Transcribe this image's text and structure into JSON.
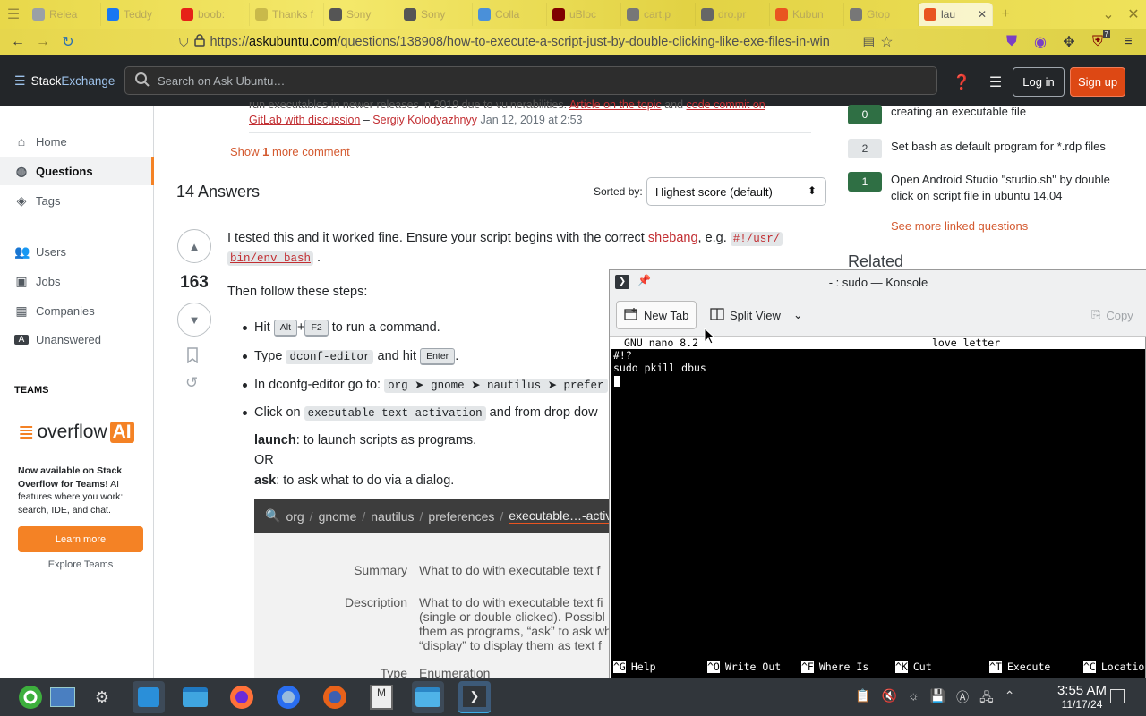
{
  "browser": {
    "tabs": [
      {
        "label": "Relea",
        "color": "#9aa0a6"
      },
      {
        "label": "Teddy",
        "color": "#1877f2"
      },
      {
        "label": "boob:",
        "color": "#e62117"
      },
      {
        "label": "Thanks f",
        "color": "#c9b94a"
      },
      {
        "label": "Sony",
        "color": "#555555"
      },
      {
        "label": "Sony",
        "color": "#555555"
      },
      {
        "label": "Colla",
        "color": "#4a90d9"
      },
      {
        "label": "uBloc",
        "color": "#800000"
      },
      {
        "label": "cart.p",
        "color": "#777777"
      },
      {
        "label": "dro.pr",
        "color": "#666666"
      },
      {
        "label": "Kubun",
        "color": "#e95420"
      },
      {
        "label": "Gtop",
        "color": "#777777"
      },
      {
        "label": "lau",
        "color": "#e95420",
        "active": true
      }
    ],
    "url_prefix": "https://",
    "url_domain": "askubuntu.com",
    "url_path": "/questions/138908/how-to-execute-a-script-just-by-double-clicking-like-exe-files-in-win",
    "ublock_count": "7"
  },
  "header": {
    "logo_a": "Stack",
    "logo_b": "Exchange",
    "search_placeholder": "Search on Ask Ubuntu…",
    "login": "Log in",
    "signup": "Sign up"
  },
  "leftnav": {
    "home": "Home",
    "questions": "Questions",
    "tags": "Tags",
    "users": "Users",
    "jobs": "Jobs",
    "companies": "Companies",
    "unanswered": "Unanswered",
    "teams_label": "TEAMS",
    "overflow": "overflow",
    "ai": "AI",
    "teams_text_bold": "Now available on Stack Overflow for Teams!",
    "teams_text": " AI features where you work: search, IDE, and chat.",
    "learn_more": "Learn more",
    "explore": "Explore Teams"
  },
  "comment": {
    "line1_text": "run executables in newer releases in 2019 due to vulnerabilities.",
    "line1_link1": "Article on the topic",
    "line1_and": " and ",
    "line1_link2": "code commit on",
    "line2_link": "GitLab with discussion",
    "author_sep": " – ",
    "author": "Sergiy Kolodyazhnyy",
    "date": " Jan 12, 2019 at 2:53",
    "show_more_a": "Show ",
    "show_more_n": "1",
    "show_more_b": " more comment"
  },
  "answers": {
    "heading": "14 Answers",
    "sorted_by": "Sorted by:",
    "sort_value": "Highest score (default)",
    "score": "163",
    "p1_a": "I tested this and it worked fine. Ensure your script begins with the correct ",
    "p1_link": "shebang",
    "p1_b": ", e.g. ",
    "p1_code1": "#!/usr/",
    "p1_code2": "bin/env bash",
    "p1_end": " .",
    "p2": "Then follow these steps:",
    "s1_a": "Hit ",
    "s1_k1": "Alt",
    "s1_plus": "+",
    "s1_k2": "F2",
    "s1_b": " to run a command.",
    "s2_a": "Type ",
    "s2_code": "dconf-editor",
    "s2_b": " and hit ",
    "s2_k": "Enter",
    "s2_c": ".",
    "s3_a": "In dconfg-editor go to: ",
    "s3_code": "org ➤ gnome ➤ nautilus ➤ prefer",
    "s4_a": "Click on ",
    "s4_code": "executable-text-activation",
    "s4_b": " and from drop dow",
    "launch_b": "launch",
    "launch_t": ": to launch scripts as programs.",
    "or": "OR",
    "ask_b": "ask",
    "ask_t": ": to ask what to do via a dialog."
  },
  "gnome": {
    "path": [
      "org",
      "gnome",
      "nautilus",
      "preferences",
      "executable…-activa"
    ],
    "summary_label": "Summary",
    "summary_value": "What to do with executable text f",
    "desc_label": "Description",
    "desc_1": "What to do with executable text fi",
    "desc_2": "(single or double clicked). Possibl",
    "desc_3": "them as programs, “ask” to ask wh",
    "desc_4": "“display” to display them as text f",
    "type_label": "Type",
    "type_value": "Enumeration"
  },
  "rightbar": {
    "linked": [
      {
        "count": "0",
        "text": "creating an executable file",
        "accepted": true
      },
      {
        "count": "2",
        "text": "Set bash as default program for *.rdp files",
        "accepted": false
      },
      {
        "count": "1",
        "text": "Open Android Studio \"studio.sh\" by double click on script file in ubuntu 14.04",
        "accepted": true
      }
    ],
    "see_more": "See more linked questions",
    "related": "Related"
  },
  "konsole": {
    "title": "- : sudo — Konsole",
    "new_tab": "New Tab",
    "split_view": "Split View",
    "copy": "Copy",
    "nano_version": "GNU nano 8.2",
    "nano_file": "love letter",
    "line1": "#!?",
    "line2": "sudo pkill dbus",
    "keys": [
      {
        "key": "^G",
        "label": "Help"
      },
      {
        "key": "^O",
        "label": "Write Out"
      },
      {
        "key": "^F",
        "label": "Where Is"
      },
      {
        "key": "^K",
        "label": "Cut"
      },
      {
        "key": "^T",
        "label": "Execute"
      },
      {
        "key": "^C",
        "label": "Locatio"
      }
    ]
  },
  "taskbar": {
    "time": "3:55 AM",
    "date": "11/17/24"
  }
}
